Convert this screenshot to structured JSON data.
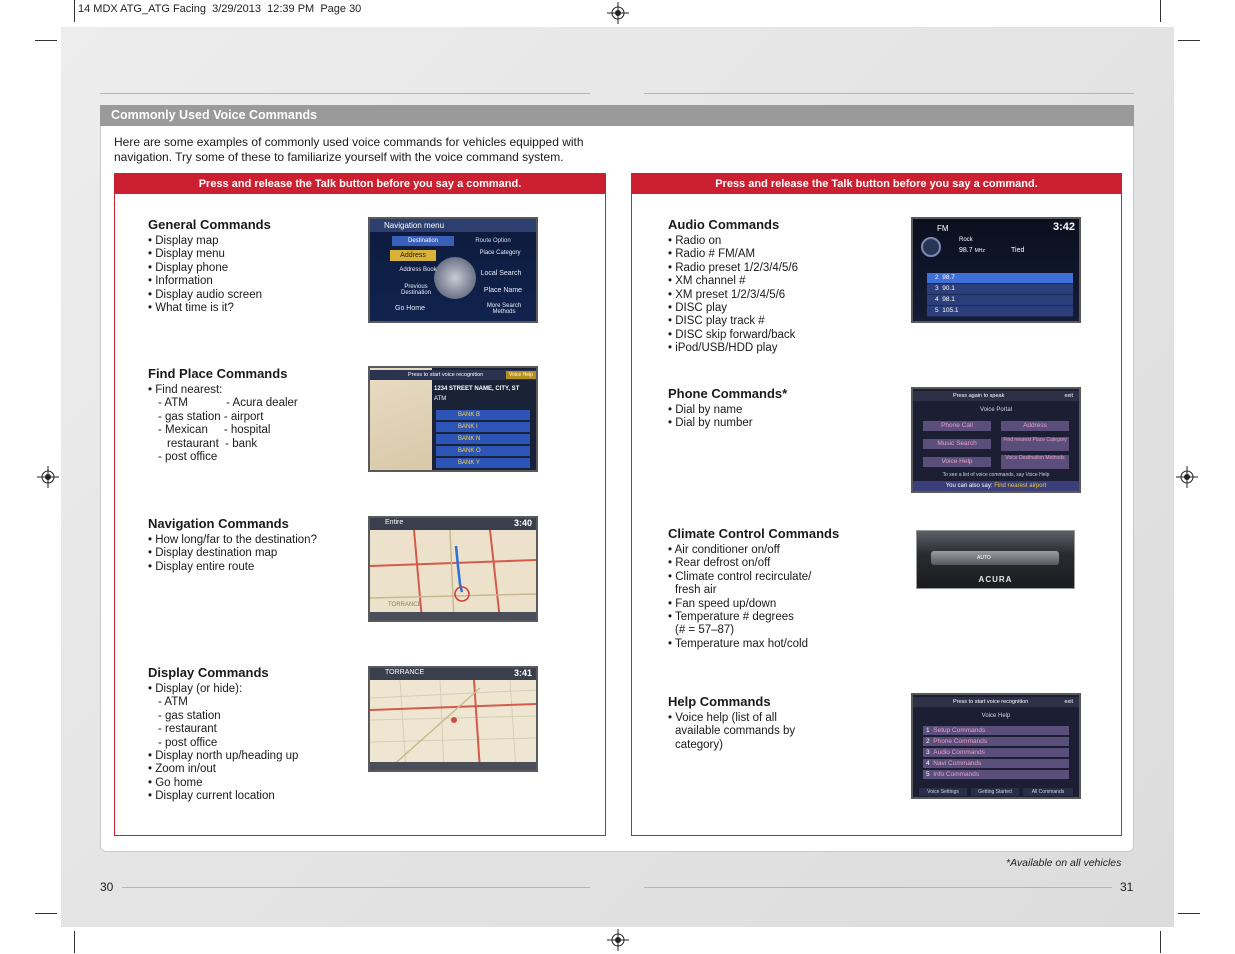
{
  "slug": "14 MDX ATG_ATG Facing  3/29/2013  12:39 PM  Page 30",
  "section_title": "Commonly Used Voice Commands",
  "intro": "Here are some examples of commonly used voice commands for vehicles equipped with navigation. Try some of these to familiarize yourself with the voice command system.",
  "left_box_header": "Press and release the Talk button before you say a command.",
  "right_box_header": "Press and release the Talk button before you say a command.",
  "general": {
    "title": "General Commands",
    "items": [
      "Display map",
      "Display menu",
      "Display phone",
      "Information",
      "Display audio screen",
      "What time is it?"
    ]
  },
  "find_place": {
    "title": "Find Place Commands",
    "lines": [
      "Find nearest:",
      "- ATM            - Acura dealer",
      "- gas station - airport",
      "- Mexican     - hospital",
      "restaurant  - bank",
      "- post office"
    ]
  },
  "navigation": {
    "title": "Navigation Commands",
    "items": [
      "How long/far to the destination?",
      "Display destination map",
      "Display entire route"
    ]
  },
  "display": {
    "title": "Display Commands",
    "lines": [
      "Display (or hide):",
      "- ATM",
      "- gas station",
      "- restaurant",
      "- post office",
      "Display north up/heading up",
      "Zoom in/out",
      "Go home",
      "Display current location"
    ]
  },
  "audio": {
    "title": "Audio Commands",
    "items": [
      "Radio on",
      "Radio # FM/AM",
      "Radio preset 1/2/3/4/5/6",
      "XM channel #",
      "XM preset 1/2/3/4/5/6",
      "DISC play",
      "DISC play track #",
      "DISC skip forward/back",
      "iPod/USB/HDD play"
    ]
  },
  "phone": {
    "title": "Phone Commands*",
    "items": [
      "Dial by name",
      "Dial by number"
    ]
  },
  "climate": {
    "title": "Climate Control Commands",
    "lines": [
      "Air conditioner on/off",
      "Rear defrost on/off",
      "Climate control recirculate/",
      "fresh air",
      "Fan speed up/down",
      "Temperature # degrees",
      "(# = 57–87)",
      "Temperature max hot/cold"
    ]
  },
  "help": {
    "title": "Help Commands",
    "lines": [
      "Voice help (list of all",
      "available commands by",
      "category)"
    ]
  },
  "screens": {
    "nav_menu": {
      "title": "Navigation menu",
      "tab1": "Destination",
      "tab2": "Route Option",
      "b1": "Address",
      "b2": "Place Category",
      "b3": "Address Book",
      "b4": "Local Search",
      "b5": "Previous Destination",
      "b6": "Place Name",
      "b7": "Go Home",
      "b8": "More Search Methods"
    },
    "find_place": {
      "hint": "Press  to start voice recognition",
      "voice_help": "Voice Help",
      "address": "1234 STREET NAME, CITY, ST",
      "category": "ATM",
      "rows": [
        "BANK B",
        "BANK I",
        "BANK N",
        "BANK O",
        "BANK Y"
      ]
    },
    "nav_map": {
      "title": "Entire",
      "time": "3:40",
      "place": "TORRANCE"
    },
    "display_map": {
      "title": "TORRANCE",
      "time": "3:41"
    },
    "audio": {
      "band": "FM",
      "time": "3:42",
      "genre": "Rock",
      "freq": "98.7",
      "unit": "MHz",
      "station": "Tied",
      "presets": [
        {
          "n": "2",
          "f": "98.7"
        },
        {
          "n": "3",
          "f": "90.1"
        },
        {
          "n": "4",
          "f": "98.1"
        },
        {
          "n": "5",
          "f": "105.1"
        }
      ]
    },
    "phone": {
      "hint": "Press  again to speak",
      "exit": "exit",
      "title": "Voice Portal",
      "b1": "Phone Call",
      "b2": "Address",
      "b3": "Music Search",
      "b4": "Find nearest Place Category",
      "b5": "Voice Help",
      "b6": "Voice Destination Methods",
      "line1": "To see a list of voice commands, say Voice Help",
      "line2a": "You can also say:",
      "line2b": "Find nearest airport"
    },
    "climate": {
      "logo": "ACURA",
      "auto": "AUTO"
    },
    "help": {
      "hint": "Press  to start voice recognition",
      "exit": "exit",
      "title": "Voice Help",
      "rows": [
        {
          "n": "1",
          "t": "Setup Commands"
        },
        {
          "n": "2",
          "t": "Phone Commands"
        },
        {
          "n": "3",
          "t": "Audio Commands"
        },
        {
          "n": "4",
          "t": "Navi Commands"
        },
        {
          "n": "5",
          "t": "Info Commands"
        }
      ],
      "tabs": [
        "Voice Settings",
        "Getting Started",
        "All Commands"
      ]
    }
  },
  "footnote": "*Available on all vehicles",
  "page_left": "30",
  "page_right": "31",
  "colors": {
    "red": "#cc2031",
    "gray_bar": "#9a9a9a",
    "screen_blue": "#1d3a8f"
  }
}
